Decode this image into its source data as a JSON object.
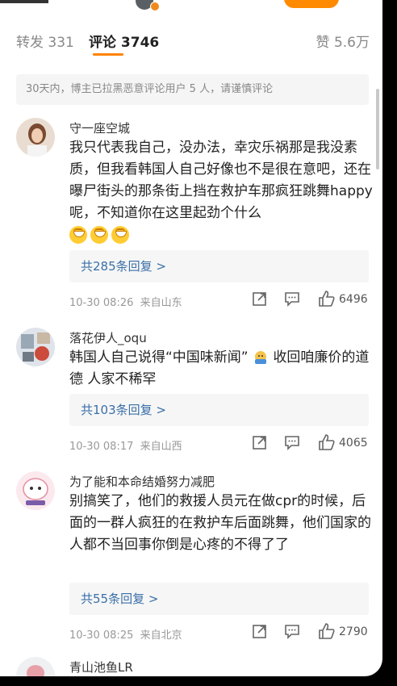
{
  "tabs": {
    "repost": "转发 331",
    "comments": "评论 3746",
    "likes": "赞 5.6万"
  },
  "notice": "30天内，博主已拉黑恶意评论用户 5 人，请谨慎评论",
  "comments": [
    {
      "user": "守一座空城",
      "text": "我只代表我自己，没办法，幸灾乐祸那是我没素质，但我看韩国人自己好像也不是很在意吧，还在曝尸街头的那条街上挡在救护车那疯狂跳舞happy呢，不知道你在这里起劲个什么",
      "replies": "共285条回复 >",
      "time": "10-30 08:26",
      "location": "来自山东",
      "likes": "6496"
    },
    {
      "user": "落花伊人_oqu",
      "text_a": "韩国人自己说得“中国味新闻”",
      "text_b": "收回咱廉价的道德 人家不稀罕",
      "replies": "共103条回复 >",
      "time": "10-30 08:17",
      "location": "来自山西",
      "likes": "4065"
    },
    {
      "user": "为了能和本命结婚努力减肥",
      "text": "别搞笑了，他们的救援人员元在做cpr的时候，后面的一群人疯狂的在救护车后面跳舞，他们国家的人都不当回事你倒是心疼的不得了了",
      "replies": "共55条回复 >",
      "time": "10-30 08:25",
      "location": "来自北京",
      "likes": "2790"
    },
    {
      "user": "青山池鱼LR"
    }
  ]
}
